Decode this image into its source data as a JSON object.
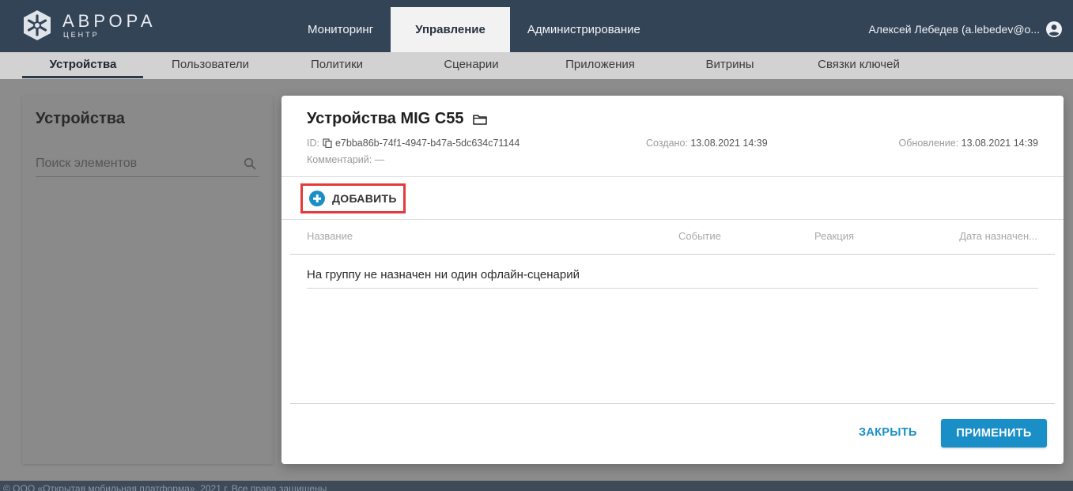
{
  "brand": {
    "name": "АВРОРА",
    "sub": "ЦЕНТР"
  },
  "topnav": [
    {
      "label": "Мониторинг"
    },
    {
      "label": "Управление"
    },
    {
      "label": "Администрирование"
    }
  ],
  "user": {
    "name": "Алексей Лебедев (a.lebedev@o..."
  },
  "subnav": [
    {
      "label": "Устройства"
    },
    {
      "label": "Пользователи"
    },
    {
      "label": "Политики"
    },
    {
      "label": "Сценарии"
    },
    {
      "label": "Приложения"
    },
    {
      "label": "Витрины"
    },
    {
      "label": "Связки ключей"
    }
  ],
  "left_panel": {
    "title": "Устройства",
    "search_placeholder": "Поиск элементов"
  },
  "dialog": {
    "title": "Устройства MIG C55",
    "id_label": "ID:",
    "id_value": "e7bba86b-74f1-4947-b47a-5dc634c71144",
    "comment_label": "Комментарий:",
    "comment_value": "—",
    "created_label": "Создано:",
    "created_value": "13.08.2021 14:39",
    "updated_label": "Обновление:",
    "updated_value": "13.08.2021 14:39",
    "add_label": "ДОБАВИТЬ",
    "columns": [
      "Название",
      "Событие",
      "Реакция",
      "Дата назначен..."
    ],
    "empty_message": "На группу не назначен ни один офлайн-сценарий",
    "close_label": "ЗАКРЫТЬ",
    "apply_label": "ПРИМЕНИТЬ"
  },
  "copyright": "© ООО «Открытая мобильная платформа», 2021 г. Все права защищены",
  "colors": {
    "header": "#344457",
    "accent": "#1a8fc7",
    "highlight": "#e33b3b"
  }
}
